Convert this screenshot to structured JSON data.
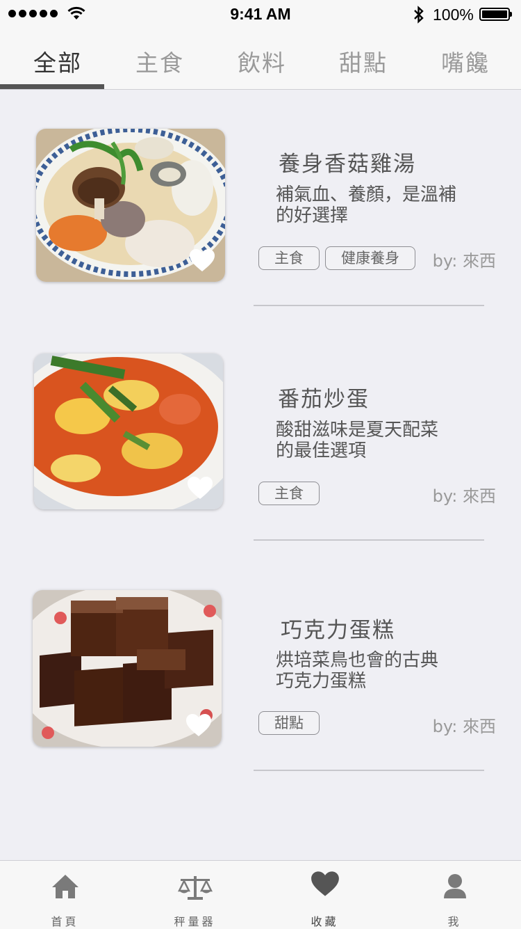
{
  "status": {
    "time": "9:41 AM",
    "battery": "100%"
  },
  "tabs": [
    {
      "label": "全部",
      "active": true
    },
    {
      "label": "主食"
    },
    {
      "label": "飲料"
    },
    {
      "label": "甜點"
    },
    {
      "label": "嘴饞"
    }
  ],
  "recipes": [
    {
      "title": "養身香菇雞湯",
      "desc_line1": "補氣血、養顏，是溫補",
      "desc_line2": "的好選擇",
      "tags": [
        "主食",
        "健康養身"
      ],
      "author": "by: 來西"
    },
    {
      "title": "番茄炒蛋",
      "desc_line1": "酸甜滋味是夏天配菜",
      "desc_line2": "的最佳選項",
      "tags": [
        "主食"
      ],
      "author": "by: 來西"
    },
    {
      "title": "巧克力蛋糕",
      "desc_line1": "烘培菜鳥也會的古典",
      "desc_line2": "巧克力蛋糕",
      "tags": [
        "甜點"
      ],
      "author": "by: 來西"
    }
  ],
  "tab_bar": [
    {
      "label": "首頁",
      "icon": "home-icon"
    },
    {
      "label": "秤量器",
      "icon": "scale-icon"
    },
    {
      "label": "收藏",
      "icon": "heart-icon",
      "active": true
    },
    {
      "label": "我",
      "icon": "user-icon"
    }
  ]
}
